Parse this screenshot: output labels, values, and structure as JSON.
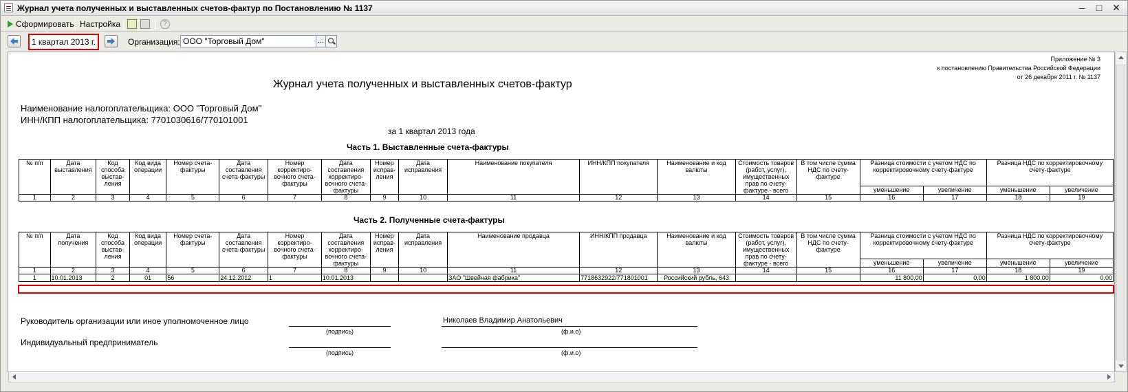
{
  "window": {
    "title": "Журнал учета полученных и выставленных счетов-фактур по Постановлению № 1137"
  },
  "toolbar": {
    "generate_label": "Сформировать",
    "settings_label": "Настройка"
  },
  "period": {
    "value": "1 квартал 2013 г."
  },
  "organization": {
    "label": "Организация:",
    "value": "ООО \"Торговый Дом\""
  },
  "doc": {
    "appendix": [
      "Приложение № 3",
      "к постановлению Правительства Российской Федерации",
      "от 26 декабря 2011 г. № 1137"
    ],
    "title": "Журнал учета полученных и выставленных счетов-фактур",
    "taxpayer_name": "Наименование налогоплательщика: ООО \"Торговый Дом\"",
    "taxpayer_inn": "ИНН/КПП налогоплательщика: 7701030616/770101001",
    "period_line": "за 1 квартал 2013 года",
    "part1_title": "Часть 1. Выставленные счета-фактуры",
    "part2_title": "Часть 2. Полученные счета-фактуры",
    "part1_headers": [
      "№ п/п",
      "Дата выставления",
      "Код способа выстав-ления",
      "Код вида операции",
      "Номер счета-фактуры",
      "Дата составления счета-фактуры",
      "Номер корректиро-вочного счета-фактуры",
      "Дата составления корректиро-вочного счета-фактуры",
      "Номер исправ-ления",
      "Дата исправления",
      "Наименование покупателя",
      "ИНН/КПП покупателя",
      "Наименование и код валюты",
      "Стоимость товаров (работ, услуг), имущественных прав по счету-фактуре - всего",
      "В том числе сумма НДС по счету-фактуре",
      "Разница стоимости с учетом НДС по корректировочному счету-фактуре",
      "Разница НДС по корректировочному счету-фактуре"
    ],
    "part2_headers": [
      "№ п/п",
      "Дата получения",
      "Код способа выстав-ления",
      "Код вида операции",
      "Номер счета-фактуры",
      "Дата составления счета-фактуры",
      "Номер корректиро-вочного счета-фактуры",
      "Дата составления корректиро-вочного счета-фактуры",
      "Номер исправ-ления",
      "Дата исправления",
      "Наименование продавца",
      "ИНН/КПП продавца",
      "Наименование и код валюты",
      "Стоимость товаров (работ, услуг), имущественных прав по счету-фактуре - всего",
      "В том числе сумма НДС по счету-фактуре",
      "Разница стоимости с учетом НДС по корректировочному счету-фактуре",
      "Разница НДС по корректировочному счету-фактуре"
    ],
    "sub_decrease": "уменьшение",
    "sub_increase": "увеличение",
    "column_numbers": [
      "1",
      "2",
      "3",
      "4",
      "5",
      "6",
      "7",
      "8",
      "9",
      "10",
      "11",
      "12",
      "13",
      "14",
      "15",
      "16",
      "17",
      "18",
      "19"
    ],
    "part2_row": [
      "1",
      "10.01.2013",
      "2",
      "01",
      "56",
      "24.12.2012",
      "1",
      "10.01.2013",
      "",
      "",
      "ЗАО \"Швейная фабрика\"",
      "7718632922/771801001",
      "Российский рубль, 643",
      "",
      "",
      "11 800,00",
      "0,00",
      "1 800,00",
      "0,00"
    ],
    "signature1_label": "Руководитель организации или иное уполномоченное лицо",
    "signature1_name": "Николаев Владимир Анатольевич",
    "signature2_label": "Индивидуальный предприниматель",
    "sign_caption": "(подпись)",
    "fio_caption": "(ф.и.о)"
  }
}
